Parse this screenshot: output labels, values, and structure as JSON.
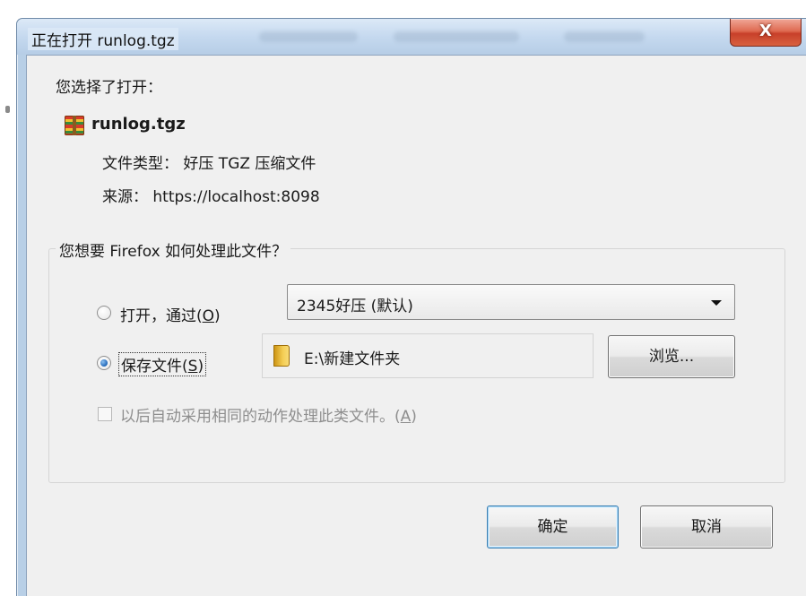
{
  "dialog": {
    "title": "正在打开 runlog.tgz",
    "close_glyph": "X",
    "chosen_label": "您选择了打开：",
    "file": {
      "icon": "archive-icon",
      "name": "runlog.tgz",
      "type_line": "文件类型： 好压 TGZ 压缩文件",
      "source_line": "来源： https://localhost:8098"
    },
    "action_group": {
      "legend": "您想要 Firefox 如何处理此文件？",
      "open_option": {
        "prefix": "打开，通过(",
        "key": "O",
        "suffix": ")",
        "selected": false
      },
      "open_app_selected": "2345好压 (默认)",
      "save_option": {
        "prefix": "保存文件(",
        "key": "S",
        "suffix": ")",
        "selected": true
      },
      "save_folder_icon": "folder-icon",
      "save_path": "E:\\新建文件夹",
      "browse_label": "浏览...",
      "remember": {
        "prefix": "以后自动采用相同的动作处理此类文件。(",
        "key": "A",
        "suffix": ")",
        "checked": false,
        "disabled": true
      }
    },
    "buttons": {
      "ok": "确定",
      "cancel": "取消"
    }
  }
}
